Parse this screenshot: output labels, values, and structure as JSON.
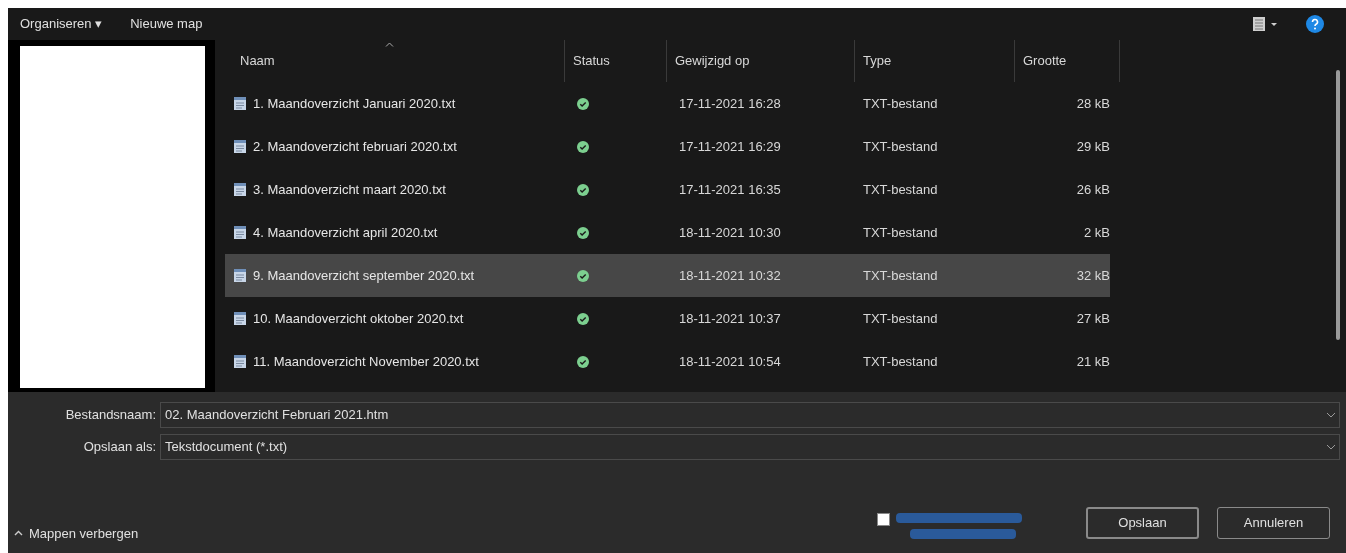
{
  "toolbar": {
    "organize": "Organiseren ▾",
    "new_folder": "Nieuwe map"
  },
  "columns": [
    {
      "label": "Naam",
      "sorted": true
    },
    {
      "label": "Status",
      "sorted": false
    },
    {
      "label": "Gewijzigd op",
      "sorted": false
    },
    {
      "label": "Type",
      "sorted": false
    },
    {
      "label": "Grootte",
      "sorted": false
    }
  ],
  "rows": [
    {
      "name": "1. Maandoverzicht Januari 2020.txt",
      "modified": "17-11-2021 16:28",
      "type": "TXT-bestand",
      "size": "28 kB",
      "selected": false
    },
    {
      "name": "2. Maandoverzicht februari 2020.txt",
      "modified": "17-11-2021 16:29",
      "type": "TXT-bestand",
      "size": "29 kB",
      "selected": false
    },
    {
      "name": "3. Maandoverzicht maart 2020.txt",
      "modified": "17-11-2021 16:35",
      "type": "TXT-bestand",
      "size": "26 kB",
      "selected": false
    },
    {
      "name": "4. Maandoverzicht april 2020.txt",
      "modified": "18-11-2021 10:30",
      "type": "TXT-bestand",
      "size": "2 kB",
      "selected": false
    },
    {
      "name": "9. Maandoverzicht september 2020.txt",
      "modified": "18-11-2021 10:32",
      "type": "TXT-bestand",
      "size": "32 kB",
      "selected": true
    },
    {
      "name": "10. Maandoverzicht oktober 2020.txt",
      "modified": "18-11-2021 10:37",
      "type": "TXT-bestand",
      "size": "27 kB",
      "selected": false
    },
    {
      "name": "11. Maandoverzicht November 2020.txt",
      "modified": "18-11-2021 10:54",
      "type": "TXT-bestand",
      "size": "21 kB",
      "selected": false
    }
  ],
  "filename": {
    "label": "Bestandsnaam:",
    "value": "02. Maandoverzicht Februari 2021.htm"
  },
  "save_as": {
    "label": "Opslaan als:",
    "value": "Tekstdocument (*.txt)"
  },
  "hide_folders": "Mappen verbergen",
  "option_checkbox": {
    "checked": false
  },
  "buttons": [
    "Opslaan",
    "Annuleren"
  ]
}
